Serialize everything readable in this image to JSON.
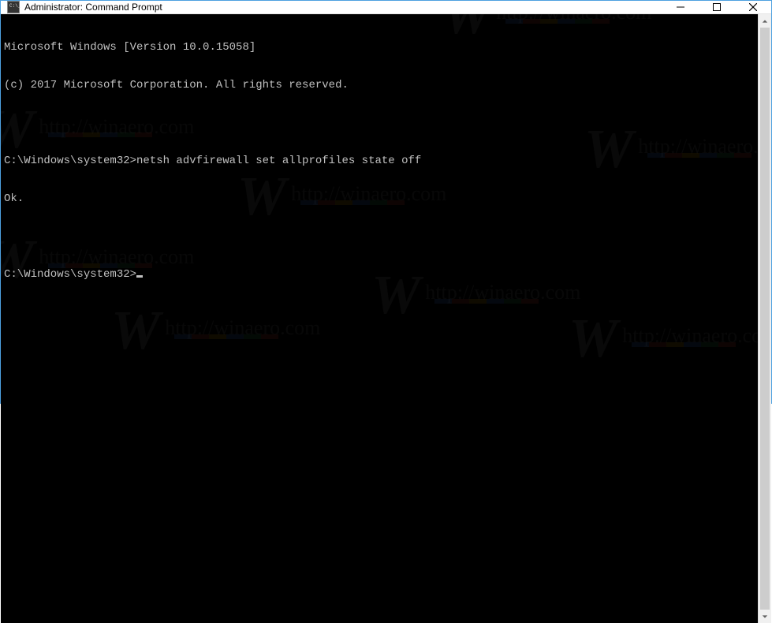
{
  "window": {
    "title": "Administrator: Command Prompt"
  },
  "console": {
    "lines": [
      "Microsoft Windows [Version 10.0.15058]",
      "(c) 2017 Microsoft Corporation. All rights reserved.",
      "",
      "C:\\Windows\\system32>netsh advfirewall set allprofiles state off",
      "Ok.",
      "",
      "C:\\Windows\\system32>"
    ]
  },
  "watermark": {
    "text": "http://winaero.com"
  }
}
